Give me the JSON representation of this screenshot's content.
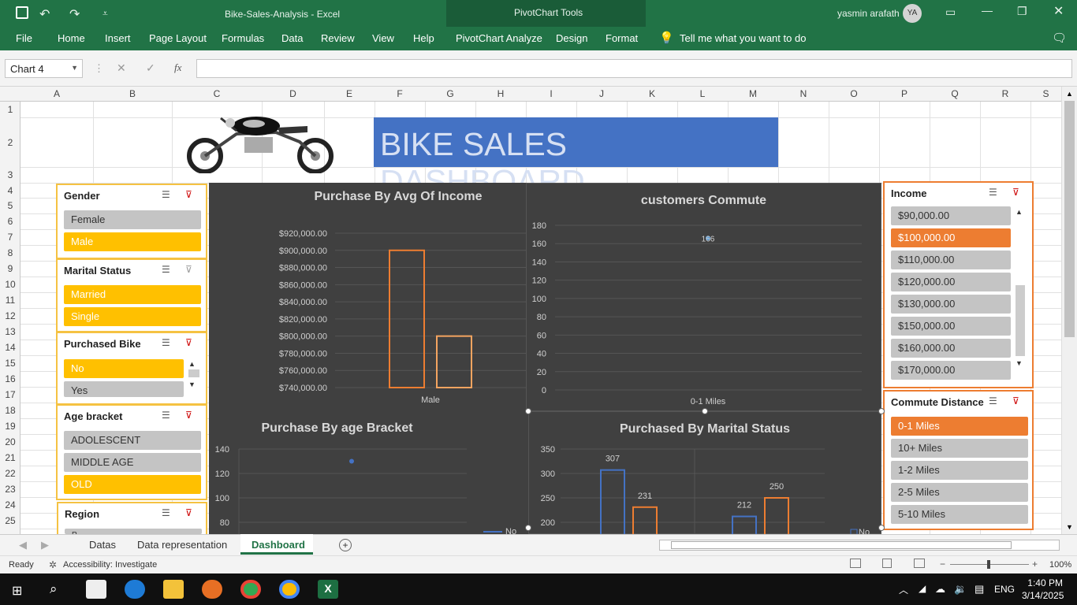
{
  "window": {
    "title": "Bike-Sales-Analysis  -  Excel",
    "context_tab": "PivotChart Tools",
    "user": "yasmin arafath",
    "user_initials": "YA"
  },
  "menu": {
    "file": "File",
    "home": "Home",
    "insert": "Insert",
    "page_layout": "Page Layout",
    "formulas": "Formulas",
    "data": "Data",
    "review": "Review",
    "view": "View",
    "help": "Help",
    "pivot_analyze": "PivotChart Analyze",
    "design": "Design",
    "format": "Format",
    "tell_me": "Tell me what you want to do"
  },
  "formula_bar": {
    "name_box": "Chart 4",
    "fx": "fx",
    "value": ""
  },
  "columns": [
    "A",
    "B",
    "C",
    "D",
    "E",
    "F",
    "G",
    "H",
    "I",
    "J",
    "K",
    "L",
    "M",
    "N",
    "O",
    "P",
    "Q",
    "R",
    "S"
  ],
  "rows": [
    "1",
    "2",
    "3",
    "4",
    "5",
    "6",
    "7",
    "8",
    "9",
    "10",
    "11",
    "12",
    "13",
    "14",
    "15",
    "16",
    "17",
    "18",
    "19",
    "20",
    "21",
    "22",
    "23",
    "24",
    "25"
  ],
  "dashboard": {
    "title": "BIKE SALES DASHBOARD"
  },
  "slicers": {
    "gender": {
      "title": "Gender",
      "items": [
        "Female",
        "Male"
      ]
    },
    "marital": {
      "title": "Marital Status",
      "items": [
        "Married",
        "Single"
      ]
    },
    "purchased": {
      "title": "Purchased Bike",
      "items": [
        "No",
        "Yes"
      ]
    },
    "age": {
      "title": "Age bracket",
      "items": [
        "ADOLESCENT",
        "MIDDLE AGE",
        "OLD"
      ]
    },
    "region": {
      "title": "Region",
      "items": [
        "P"
      ]
    },
    "income": {
      "title": "Income",
      "items": [
        "$90,000.00",
        "$100,000.00",
        "$110,000.00",
        "$120,000.00",
        "$130,000.00",
        "$150,000.00",
        "$160,000.00",
        "$170,000.00"
      ]
    },
    "commute": {
      "title": "Commute Distance",
      "items": [
        "0-1 Miles",
        "10+ Miles",
        "1-2 Miles",
        "2-5 Miles",
        "5-10 Miles"
      ]
    }
  },
  "chart_data": [
    {
      "type": "bar",
      "title": "Purchase By Avg Of Income",
      "categories": [
        "Male"
      ],
      "series": [
        {
          "values": [
            900000
          ]
        },
        {
          "values": [
            800000
          ]
        }
      ],
      "ylim": [
        740000,
        920000
      ],
      "yticks": [
        "$920,000.00",
        "$900,000.00",
        "$880,000.00",
        "$860,000.00",
        "$840,000.00",
        "$820,000.00",
        "$800,000.00",
        "$780,000.00",
        "$760,000.00",
        "$740,000.00"
      ]
    },
    {
      "type": "line",
      "title": "customers Commute",
      "categories": [
        "0-1 Miles"
      ],
      "values": [
        166
      ],
      "data_label": "166",
      "ylim": [
        0,
        180
      ],
      "yticks": [
        "180",
        "160",
        "140",
        "120",
        "100",
        "80",
        "60",
        "40",
        "20",
        "0"
      ]
    },
    {
      "type": "line",
      "title": "Purchase By age Bracket",
      "yticks": [
        "140",
        "120",
        "100",
        "80"
      ],
      "values": [
        130
      ],
      "legend": "No"
    },
    {
      "type": "bar",
      "title": "Purchased By Marital Status",
      "yticks": [
        "350",
        "300",
        "250",
        "200"
      ],
      "series": [
        {
          "values": [
            307,
            212
          ]
        },
        {
          "values": [
            231,
            250
          ]
        }
      ],
      "data_labels": [
        "307",
        "231",
        "212",
        "250"
      ],
      "legend": "No"
    }
  ],
  "sheets": {
    "tab1": "Datas",
    "tab2": "Data representation",
    "tab3": "Dashboard"
  },
  "status": {
    "ready": "Ready",
    "accessibility": "Accessibility: Investigate",
    "zoom": "100%"
  },
  "taskbar": {
    "time": "1:40 PM",
    "date": "3/14/2025",
    "lang": "ENG"
  },
  "colors": {
    "excel_green": "#217346",
    "chart_bg": "#404040",
    "slicer_selected": "#ffc000",
    "accent_orange": "#ed7d31",
    "dashboard_title_bg": "#4472c4"
  }
}
